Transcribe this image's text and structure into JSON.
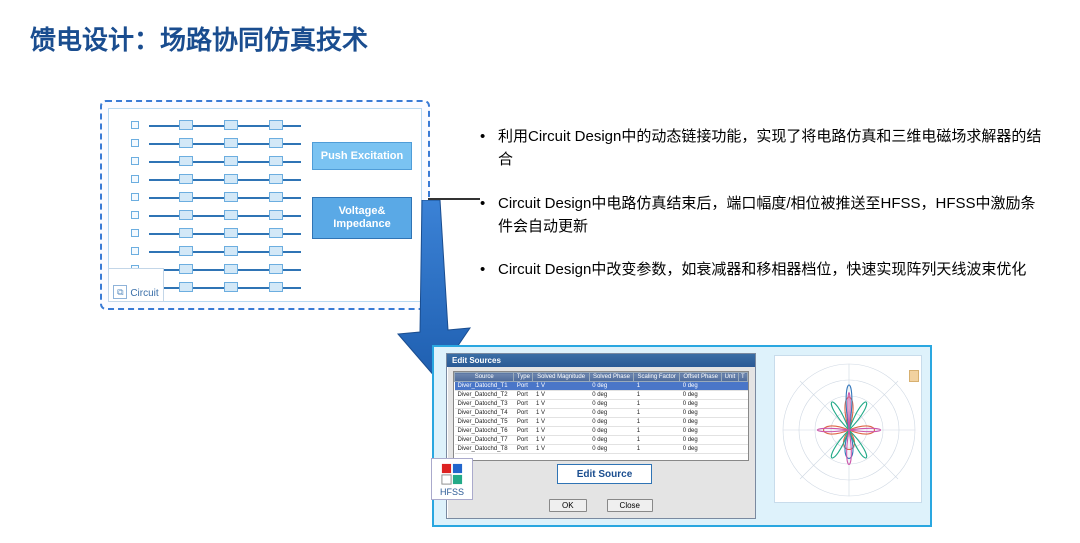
{
  "title": "馈电设计：场路协同仿真技术",
  "circuit": {
    "push_label": "Push Excitation",
    "voltage_label": "Voltage&\nImpedance",
    "panel_name": "Circuit"
  },
  "bullets": [
    "利用Circuit Design中的动态链接功能，实现了将电路仿真和三维电磁场求解器的结合",
    "Circuit Design中电路仿真结束后，端口幅度/相位被推送至HFSS，HFSS中激励条件会自动更新",
    "Circuit Design中改变参数，如衰减器和移相器档位，快速实现阵列天线波束优化"
  ],
  "hfss": {
    "tag": "HFSS",
    "dialog_title": "Edit Sources",
    "edit_source_btn": "Edit Source",
    "ok_btn": "OK",
    "close_btn": "Close",
    "headers": [
      "Source",
      "Type",
      "Solved Magnitude",
      "Solved Phase",
      "Scaling Factor",
      "Offset Phase",
      "Unit",
      "T"
    ],
    "rows": [
      {
        "src": "Diver_Datochd_T1",
        "type": "Port",
        "mag": "1 V",
        "ph": "0 deg",
        "sf": "1",
        "op": "0 deg"
      },
      {
        "src": "Diver_Datochd_T2",
        "type": "Port",
        "mag": "1 V",
        "ph": "0 deg",
        "sf": "1",
        "op": "0 deg"
      },
      {
        "src": "Diver_Datochd_T3",
        "type": "Port",
        "mag": "1 V",
        "ph": "0 deg",
        "sf": "1",
        "op": "0 deg"
      },
      {
        "src": "Diver_Datochd_T4",
        "type": "Port",
        "mag": "1 V",
        "ph": "0 deg",
        "sf": "1",
        "op": "0 deg"
      },
      {
        "src": "Diver_Datochd_T5",
        "type": "Port",
        "mag": "1 V",
        "ph": "0 deg",
        "sf": "1",
        "op": "0 deg"
      },
      {
        "src": "Diver_Datochd_T6",
        "type": "Port",
        "mag": "1 V",
        "ph": "0 deg",
        "sf": "1",
        "op": "0 deg"
      },
      {
        "src": "Diver_Datochd_T7",
        "type": "Port",
        "mag": "1 V",
        "ph": "0 deg",
        "sf": "1",
        "op": "0 deg"
      },
      {
        "src": "Diver_Datochd_T8",
        "type": "Port",
        "mag": "1 V",
        "ph": "0 deg",
        "sf": "1",
        "op": "0 deg"
      }
    ]
  },
  "chart_data": {
    "type": "polar",
    "title": "Radiation Pattern",
    "note": "Multi-series antenna gain polar plot, schematic only, values not legible"
  }
}
